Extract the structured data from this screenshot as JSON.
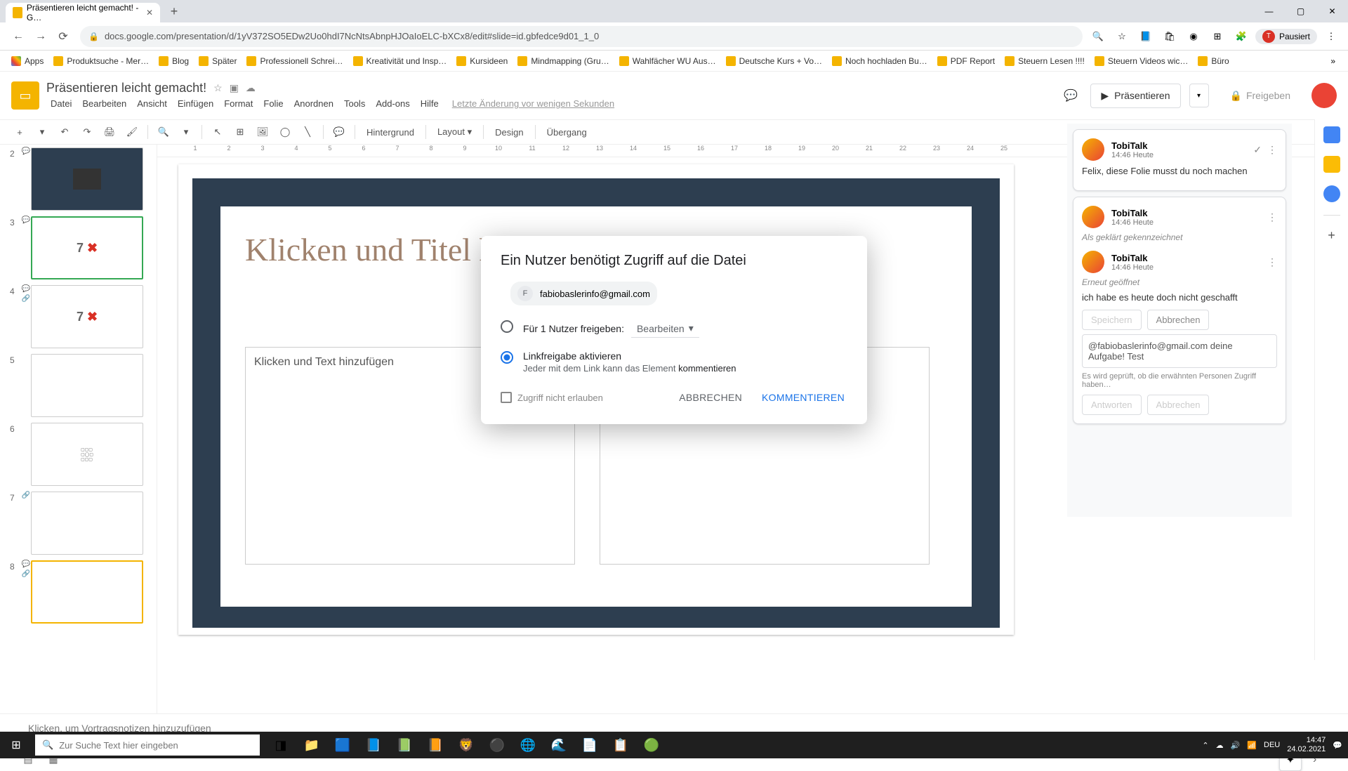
{
  "browser": {
    "tab_title": "Präsentieren leicht gemacht! - G…",
    "url": "docs.google.com/presentation/d/1yV372SO5EDw2Uo0hdI7NcNtsAbnpHJOaIoELC-bXCx8/edit#slide=id.gbfedce9d01_1_0",
    "profile_status": "Pausiert",
    "bookmarks": [
      "Apps",
      "Produktsuche - Mer…",
      "Blog",
      "Später",
      "Professionell Schrei…",
      "Kreativität und Insp…",
      "Kursideen",
      "Mindmapping  (Gru…",
      "Wahlfächer WU Aus…",
      "Deutsche Kurs + Vo…",
      "Noch hochladen Bu…",
      "PDF Report",
      "Steuern Lesen !!!!",
      "Steuern Videos wic…",
      "Büro"
    ]
  },
  "app": {
    "title": "Präsentieren leicht gemacht!",
    "menus": [
      "Datei",
      "Bearbeiten",
      "Ansicht",
      "Einfügen",
      "Format",
      "Folie",
      "Anordnen",
      "Tools",
      "Add-ons",
      "Hilfe"
    ],
    "status": "Letzte Änderung vor wenigen Sekunden",
    "present_label": "Präsentieren",
    "share_label": "Freigeben"
  },
  "toolbar": {
    "background": "Hintergrund",
    "layout": "Layout",
    "design": "Design",
    "transition": "Übergang"
  },
  "ruler": [
    "1",
    "2",
    "3",
    "4",
    "5",
    "6",
    "7",
    "8",
    "9",
    "10",
    "11",
    "12",
    "13",
    "14",
    "15",
    "16",
    "17",
    "18",
    "19",
    "20",
    "21",
    "22",
    "23",
    "24",
    "25"
  ],
  "slide": {
    "title_placeholder": "Klicken und Titel hinzufügen",
    "text_placeholder": "Klicken und Text hinzufügen"
  },
  "notes": {
    "placeholder": "Klicken, um Vortragsnotizen hinzuzufügen"
  },
  "thumbnails": [
    {
      "num": "2",
      "label": ""
    },
    {
      "num": "3",
      "label": "7 ✖"
    },
    {
      "num": "4",
      "label": "7 ✖"
    },
    {
      "num": "5",
      "label": ""
    },
    {
      "num": "6",
      "label": ""
    },
    {
      "num": "7",
      "label": ""
    },
    {
      "num": "8",
      "label": ""
    }
  ],
  "comments": {
    "c1": {
      "user": "TobiTalk",
      "time": "14:46 Heute",
      "body": "Felix, diese Folie musst du noch machen"
    },
    "c2": {
      "user": "TobiTalk",
      "time": "14:46 Heute",
      "status": "Als geklärt gekennzeichnet"
    },
    "c3": {
      "user": "TobiTalk",
      "time": "14:46 Heute",
      "status": "Erneut geöffnet",
      "body": "ich habe es heute doch nicht geschafft"
    },
    "save_btn": "Speichern",
    "cancel_btn": "Abbrechen",
    "draft": "@fabiobaslerinfo@gmail.com deine Aufgabe! Test",
    "pending": "Es wird geprüft, ob die erwähnten Personen Zugriff haben…",
    "reply_btn": "Antworten",
    "cancel2_btn": "Abbrechen"
  },
  "modal": {
    "title": "Ein Nutzer benötigt Zugriff auf die Datei",
    "user_initial": "F",
    "user_email": "fabiobaslerinfo@gmail.com",
    "opt1_label": "Für 1 Nutzer freigeben:",
    "opt1_select": "Bearbeiten",
    "opt2_label": "Linkfreigabe aktivieren",
    "opt2_sub_prefix": "Jeder mit dem Link kann das Element ",
    "opt2_sub_bold": "kommentieren",
    "deny_label": "Zugriff nicht erlauben",
    "cancel": "ABBRECHEN",
    "confirm": "KOMMENTIEREN"
  },
  "taskbar": {
    "search_placeholder": "Zur Suche Text hier eingeben",
    "lang": "DEU",
    "time": "14:47",
    "date": "24.02.2021"
  }
}
